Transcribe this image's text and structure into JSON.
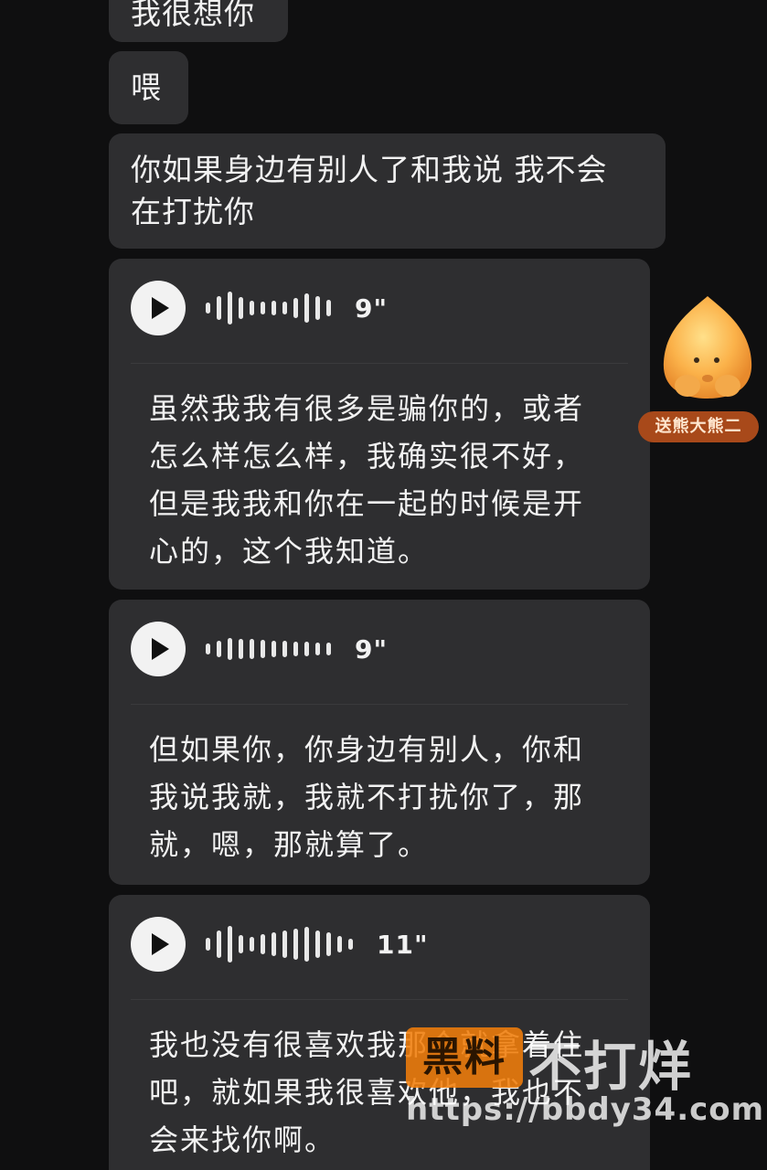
{
  "messages": {
    "m1": {
      "text": "我很想你"
    },
    "m2": {
      "text": "喂"
    },
    "m3": {
      "lines": [
        "你如果身边有别人了和我说  我不会",
        "在打扰你"
      ]
    }
  },
  "voice": [
    {
      "duration": "9\"",
      "transcript": [
        "虽然我我有很多是骗你的，或者",
        "怎么样怎么样，我确实很不好，",
        "但是我我和你在一起的时候是开",
        "心的，这个我知道。"
      ]
    },
    {
      "duration": "9\"",
      "transcript": [
        "但如果你，你身边有别人，你和",
        "我说我就，我就不打扰你了，那",
        "就，嗯，那就算了。"
      ]
    },
    {
      "duration": "11\"",
      "transcript": [
        "我也没有很喜欢我那个就拿着住",
        "吧，就如果我很喜欢他，我也不",
        "会来找你啊。"
      ]
    }
  ],
  "sticker": {
    "icon": "peach-bear-icon",
    "label": "送熊大熊二"
  },
  "watermark": {
    "logo": "黑料",
    "title": "不打烊",
    "url": "https://bbdy34.com"
  },
  "colors": {
    "background": "#0f0f10",
    "bubble": "#2e2e30",
    "badge": "#a8491a",
    "watermark_orange": "#f07d0a"
  }
}
